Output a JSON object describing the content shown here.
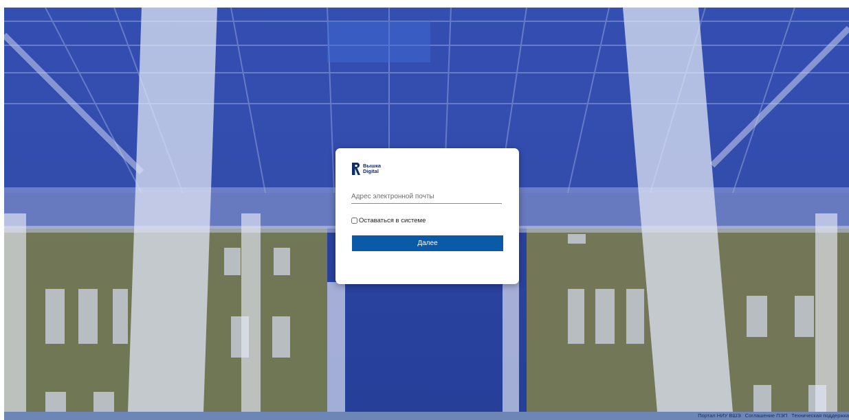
{
  "login": {
    "logo": {
      "icon": "hse-logo-icon",
      "line1": "Вышка",
      "line2": "Digital"
    },
    "email_placeholder": "Адрес электронной почты",
    "email_value": "",
    "remember_label": "Оставаться в системе",
    "remember_checked": false,
    "next_button_label": "Далее"
  },
  "footer": {
    "links": [
      "Портал НИУ ВШЭ",
      "Соглашение ПЭП",
      "Техническая поддержка"
    ]
  },
  "colors": {
    "overlay_blue": "#2b45a4",
    "button_blue": "#0a5aa8",
    "footer_bar": "#6e86b6",
    "card_bg": "#ffffff"
  }
}
